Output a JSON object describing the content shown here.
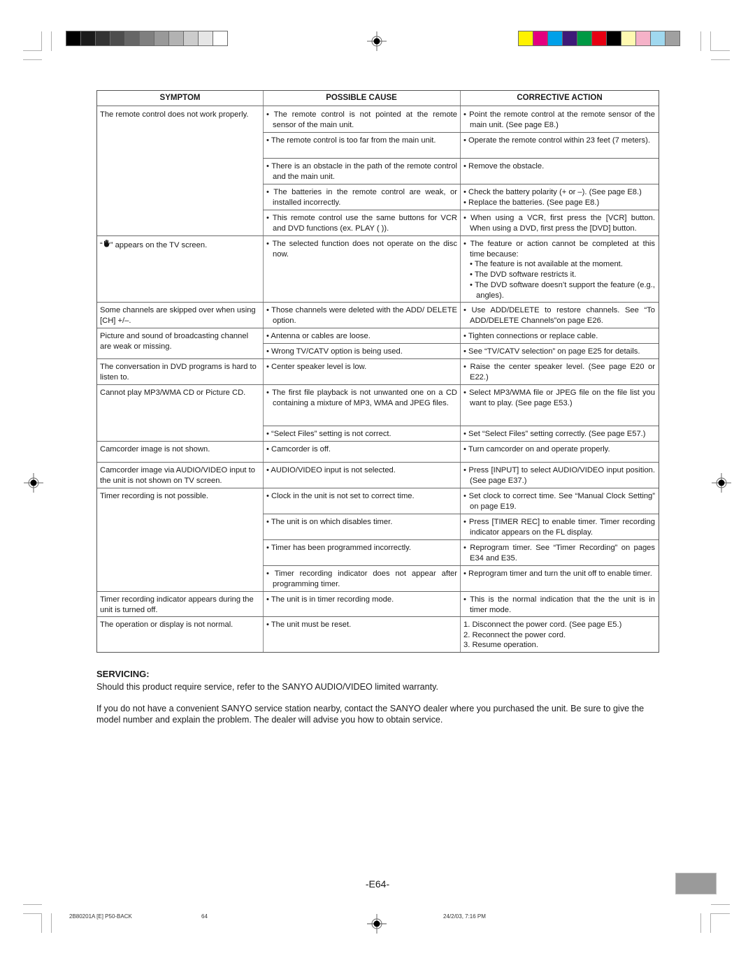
{
  "print_marks": {
    "gray_swatches": [
      "#000000",
      "#1a1a1a",
      "#333333",
      "#4d4d4d",
      "#666666",
      "#7f7f7f",
      "#999999",
      "#b2b2b2",
      "#cccccc",
      "#e6e6e6",
      "#ffffff"
    ],
    "color_swatches": [
      "#fff200",
      "#e4007f",
      "#00a0e9",
      "#3e1a78",
      "#009944",
      "#e60012",
      "#000000",
      "#fff9b1",
      "#f5b2c8",
      "#a0d8ef",
      "#a0a0a0"
    ],
    "registration_icon": "crosshair-registration-icon"
  },
  "table": {
    "headers": {
      "symptom": "SYMPTOM",
      "cause": "POSSIBLE CAUSE",
      "action": "CORRECTIVE ACTION"
    },
    "rows": [
      {
        "symptom": "The remote control does not work properly.",
        "causes": [
          {
            "cause": "The remote control is not pointed at the remote sensor of the main unit.",
            "actions": [
              "Point the remote control at the remote sensor of the main unit. (See page E8.)"
            ]
          },
          {
            "cause": "The remote control is too far from the main unit.",
            "actions": [
              "Operate the remote control within 23 feet (7 meters)."
            ]
          },
          {
            "cause": "There is an obstacle in the path of the remote control and the main unit.",
            "actions": [
              "Remove the obstacle."
            ]
          },
          {
            "cause": "The batteries in the remote control are weak, or installed incorrectly.",
            "actions": [
              "Check the battery polarity (+ or –). (See page E8.)",
              "Replace the batteries. (See page E8.)"
            ]
          },
          {
            "cause": "This remote control use the same buttons for VCR and DVD functions (ex. PLAY (   )).",
            "actions": [
              "When using a VCR, first press the [VCR] button. When using a DVD, first press the [DVD] button."
            ]
          }
        ]
      },
      {
        "symptom_prefix": "“",
        "symptom_icon": "hand-stop-icon",
        "symptom": "” appears on the TV screen.",
        "causes": [
          {
            "cause": "The selected function does not operate on the disc now.",
            "actions": [
              "The feature or action cannot be completed at this time because:"
            ],
            "sub_actions": [
              "The feature is not available at the moment.",
              "The DVD software restricts it.",
              "The DVD software doesn’t support the feature (e.g., angles)."
            ]
          }
        ]
      },
      {
        "symptom": "Some channels are skipped over when using [CH] +/–.",
        "causes": [
          {
            "cause": "Those channels were deleted with the ADD/ DELETE option.",
            "actions": [
              "Use ADD/DELETE to restore channels. See “To ADD/DELETE Channels”on page E26."
            ]
          }
        ]
      },
      {
        "symptom": "Picture and sound of broadcasting channel are weak or missing.",
        "causes": [
          {
            "cause": "Antenna or cables are loose.",
            "actions": [
              "Tighten connections or replace cable."
            ]
          },
          {
            "cause": "Wrong TV/CATV option is being used.",
            "actions": [
              "See “TV/CATV selection” on page E25 for details."
            ]
          }
        ]
      },
      {
        "symptom": "The conversation in DVD programs is hard to listen to.",
        "causes": [
          {
            "cause": "Center speaker level is low.",
            "actions": [
              "Raise the center speaker level. (See page E20 or E22.)"
            ]
          }
        ]
      },
      {
        "symptom": "Cannot play MP3/WMA CD or Picture CD.",
        "causes": [
          {
            "cause": "The first file playback is not unwanted one on a CD containing a mixture of MP3, WMA and JPEG files.",
            "actions": [
              "Select MP3/WMA file or JPEG file on the file list you want to play. (See page E53.)"
            ]
          },
          {
            "cause": "“Select Files” setting is not correct.",
            "actions": [
              "Set “Select Files” setting correctly. (See page E57.)"
            ]
          }
        ]
      },
      {
        "symptom": "Camcorder image is not shown.",
        "causes": [
          {
            "cause": "Camcorder is off.",
            "actions": [
              "Turn camcorder on and operate properly."
            ]
          }
        ]
      },
      {
        "symptom": "Camcorder image via AUDIO/VIDEO input to the unit is not shown on TV screen.",
        "causes": [
          {
            "cause": "AUDIO/VIDEO input is not selected.",
            "actions": [
              "Press [INPUT] to select AUDIO/VIDEO input position. (See page E37.)"
            ]
          }
        ]
      },
      {
        "symptom": "Timer recording is not possible.",
        "causes": [
          {
            "cause": "Clock in the unit is not set to correct time.",
            "actions": [
              "Set clock to correct time. See “Manual Clock Setting” on page E19."
            ]
          },
          {
            "cause": "The unit is on which disables timer.",
            "actions": [
              "Press [TIMER REC] to enable timer. Timer recording indicator appears on the FL display."
            ]
          },
          {
            "cause": "Timer has been programmed incorrectly.",
            "actions": [
              "Reprogram timer. See “Timer Recording” on pages E34 and E35."
            ]
          },
          {
            "cause": "Timer recording indicator does not appear after programming timer.",
            "actions": [
              "Reprogram timer and turn the unit off to enable timer."
            ]
          }
        ]
      },
      {
        "symptom": "Timer recording indicator appears during the unit is turned off.",
        "causes": [
          {
            "cause": "The unit is in timer recording mode.",
            "actions": [
              "This is the normal indication that the the unit is in timer mode."
            ]
          }
        ]
      },
      {
        "symptom": "The operation or display is not normal.",
        "causes": [
          {
            "cause": "The unit must be reset.",
            "numbered_actions": [
              "1. Disconnect the power cord. (See page E5.)",
              "2. Reconnect the power cord.",
              "3. Resume operation."
            ]
          }
        ]
      }
    ]
  },
  "servicing": {
    "title": "SERVICING:",
    "paragraph1": "Should this product require service, refer to the SANYO AUDIO/VIDEO limited warranty.",
    "paragraph2": "If you do not have a convenient SANYO service station nearby, contact the SANYO dealer where you purchased the unit. Be sure to give the model number and explain the problem. The dealer will advise you how to obtain service."
  },
  "page_number": "-E64-",
  "footer": {
    "file": "2B80201A [E] P50-BACK",
    "page": "64",
    "timestamp": "24/2/03, 7:16 PM"
  }
}
